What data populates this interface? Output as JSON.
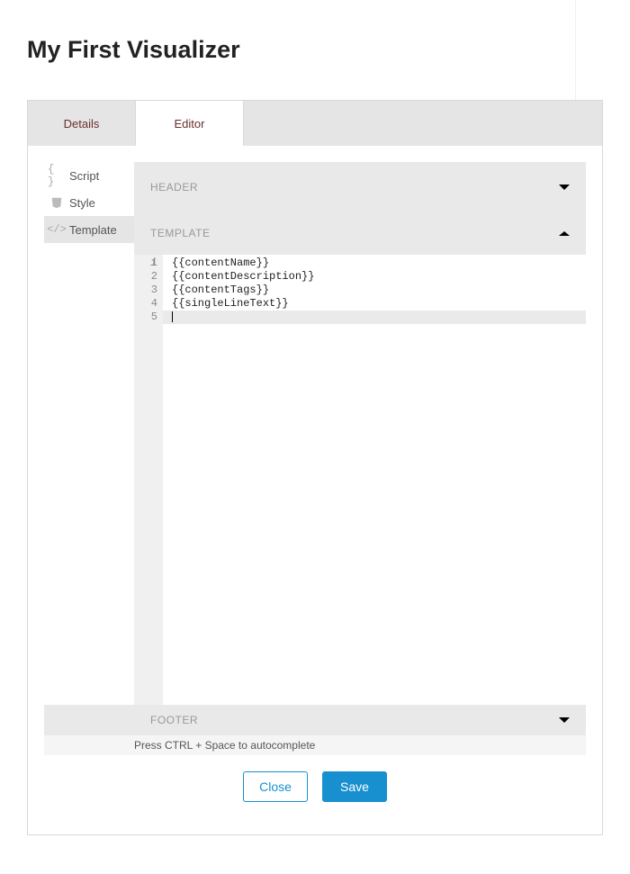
{
  "header": {
    "title": "My First Visualizer"
  },
  "tabs": {
    "details": "Details",
    "editor": "Editor"
  },
  "sidebar": {
    "script": "Script",
    "style": "Style",
    "template": "Template"
  },
  "sections": {
    "header": "HEADER",
    "template": "TEMPLATE",
    "footer": "FOOTER"
  },
  "code": {
    "gutter_info": "i",
    "line_numbers": [
      "1",
      "2",
      "3",
      "4",
      "5"
    ],
    "lines": [
      "{{contentName}}",
      "{{contentDescription}}",
      "{{contentTags}}",
      "{{singleLineText}}",
      ""
    ]
  },
  "hint": "Press CTRL + Space to autocomplete",
  "buttons": {
    "close": "Close",
    "save": "Save"
  }
}
